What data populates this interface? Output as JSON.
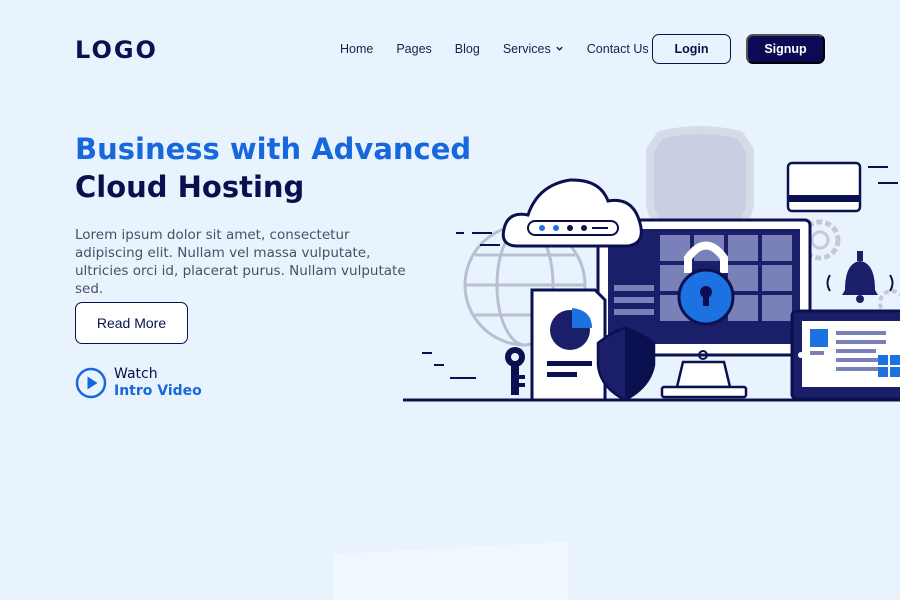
{
  "header": {
    "logo": "LOGO",
    "nav": [
      "Home",
      "Pages",
      "Blog",
      "Services",
      "Contact Us"
    ],
    "login_label": "Login",
    "signup_label": "Signup"
  },
  "hero": {
    "title_line1": "Business with Advanced",
    "title_line2": "Cloud Hosting",
    "description": "Lorem ipsum dolor sit amet, consectetur adipiscing elit. Nullam vel massa vulputate, ultricies orci id, placerat purus. Nullam vulputate sed.",
    "read_more_label": "Read More",
    "watch_label": "Watch",
    "intro_video_label": "Intro Video"
  },
  "colors": {
    "background": "#e9f3fe",
    "navy": "#0b0a55",
    "accent_blue": "#1768dd"
  },
  "icons": [
    "chevron-down-icon",
    "play-icon",
    "cloud-icon",
    "lock-icon",
    "shield-icon",
    "key-icon",
    "bell-icon",
    "gear-icon",
    "globe-icon",
    "credit-card-icon",
    "monitor-icon",
    "document-icon"
  ]
}
